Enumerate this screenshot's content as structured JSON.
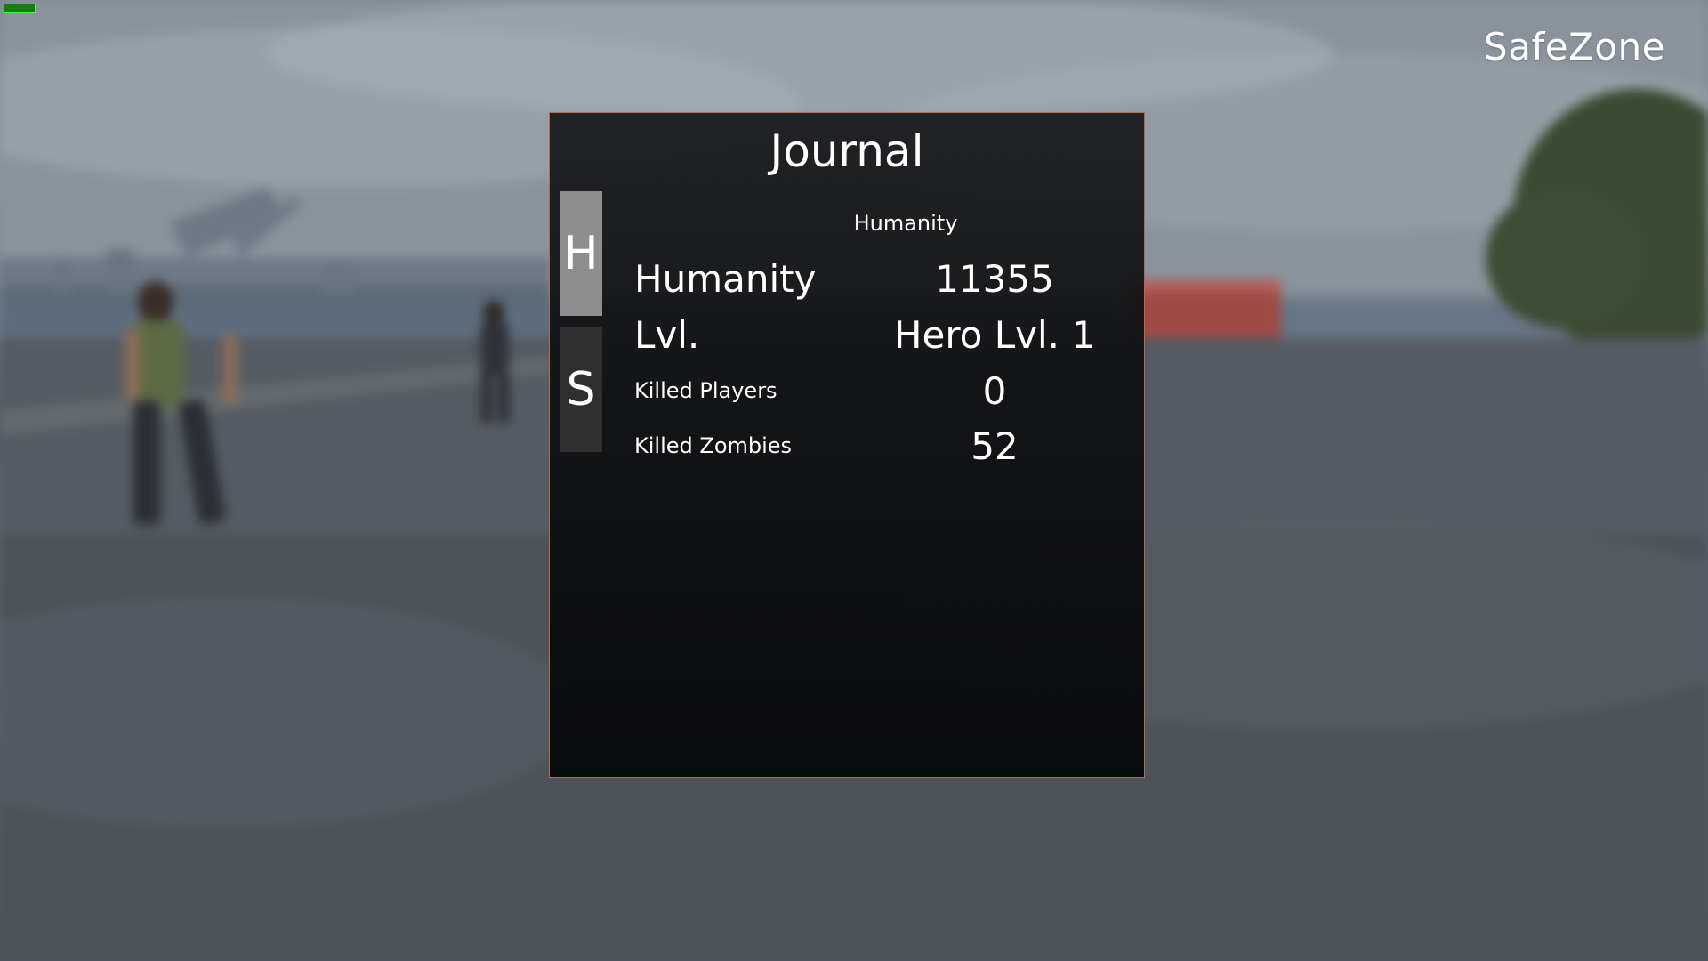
{
  "hud": {
    "server_name": "SafeZone"
  },
  "journal": {
    "title": "Journal",
    "tabs": [
      {
        "label": "H",
        "active": true
      },
      {
        "label": "S",
        "active": false
      }
    ],
    "section_header": "Humanity",
    "stats": [
      {
        "label": "Humanity",
        "value": "11355"
      },
      {
        "label": "Lvl.",
        "value": "Hero Lvl. 1"
      },
      {
        "label": "Killed Players",
        "value": "0"
      },
      {
        "label": "Killed Zombies",
        "value": "52"
      }
    ]
  },
  "colors": {
    "panel_border": "#b06a56",
    "active_tab": "#8e8e8e",
    "inactive_tab": "#2f2f2f",
    "hud_indicator": "#1a7a1a"
  }
}
